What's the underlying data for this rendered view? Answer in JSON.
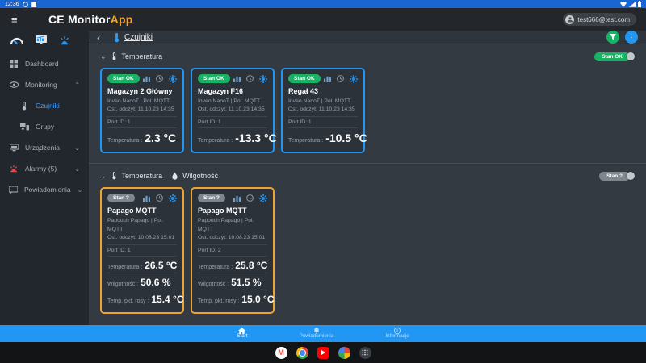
{
  "status_bar": {
    "time": "12:36"
  },
  "app_bar": {
    "menu_icon": "≡",
    "title_primary": "CE Monitor",
    "title_accent": "App",
    "user_email": "test666@test.com"
  },
  "icons": {
    "back": "‹",
    "chevron_down": "⌄",
    "chevron_up": "⌃",
    "kebab": "⋮"
  },
  "sidebar": {
    "items": [
      {
        "label": "Dashboard"
      },
      {
        "label": "Monitoring"
      },
      {
        "label": "Czujniki"
      },
      {
        "label": "Grupy"
      },
      {
        "label": "Urządzenia"
      },
      {
        "label": "Alarmy (5)"
      },
      {
        "label": "Powiadomienia"
      }
    ]
  },
  "content_header": {
    "title": "Czujniki"
  },
  "sections": [
    {
      "tags": [
        {
          "label": "Temperatura"
        }
      ],
      "status": {
        "label": "Stan OK"
      },
      "cards": [
        {
          "status": "Stan OK",
          "title": "Magazyn 2 Główny",
          "device": "Inveo NanoT | Pol. MQTT",
          "last_read": "Ost. odczyt: 11.10.23 14:35",
          "port": "Port ID: 1",
          "readings": [
            {
              "label": "Temperatura :",
              "value": "2.3 °C"
            }
          ]
        },
        {
          "status": "Stan OK",
          "title": "Magazyn F16",
          "device": "Inveo NanoT | Pol. MQTT",
          "last_read": "Ost. odczyt: 11.10.23 14:35",
          "port": "Port ID: 1",
          "readings": [
            {
              "label": "Temperatura :",
              "value": "-13.3 °C"
            }
          ]
        },
        {
          "status": "Stan OK",
          "title": "Regał 43",
          "device": "Inveo NanoT | Pol. MQTT",
          "last_read": "Ost. odczyt: 11.10.23 14:35",
          "port": "Port ID: 1",
          "readings": [
            {
              "label": "Temperatura :",
              "value": "-10.5 °C"
            }
          ]
        }
      ]
    },
    {
      "tags": [
        {
          "label": "Temperatura"
        },
        {
          "label": "Wilgotność"
        }
      ],
      "status": {
        "label": "Stan ?"
      },
      "cards": [
        {
          "status": "Stan ?",
          "title": "Papago MQTT",
          "device": "Papouch Papago | Pol. MQTT",
          "last_read": "Ost. odczyt: 10.08.23 15:01",
          "port": "Port ID: 1",
          "readings": [
            {
              "label": "Temperatura :",
              "value": "26.5 °C"
            },
            {
              "label": "Wilgotność :",
              "value": "50.6 %"
            },
            {
              "label": "Temp. pkt. rosy :",
              "value": "15.4 °C"
            }
          ]
        },
        {
          "status": "Stan ?",
          "title": "Papago MQTT",
          "device": "Papouch Papago | Pol. MQTT",
          "last_read": "Ost. odczyt: 10.08.23 15:01",
          "port": "Port ID: 2",
          "readings": [
            {
              "label": "Temperatura :",
              "value": "25.8 °C"
            },
            {
              "label": "Wilgotność :",
              "value": "51.5 %"
            },
            {
              "label": "Temp. pkt. rosy :",
              "value": "15.0 °C"
            }
          ]
        }
      ]
    }
  ],
  "bottom_nav": {
    "items": [
      {
        "label": "Start"
      },
      {
        "label": "Powiadomienia"
      },
      {
        "label": "Informacje"
      }
    ]
  },
  "taskbar_apps": [
    "gmail",
    "chrome",
    "youtube",
    "photos",
    "app-drawer"
  ],
  "colors": {
    "accent_blue": "#2196f3",
    "accent_green": "#17b364",
    "accent_orange": "#f0a330",
    "alarm_red": "#e5484d",
    "status_bar_blue": "#1966d2",
    "title_accent_orange": "#f5a623"
  }
}
